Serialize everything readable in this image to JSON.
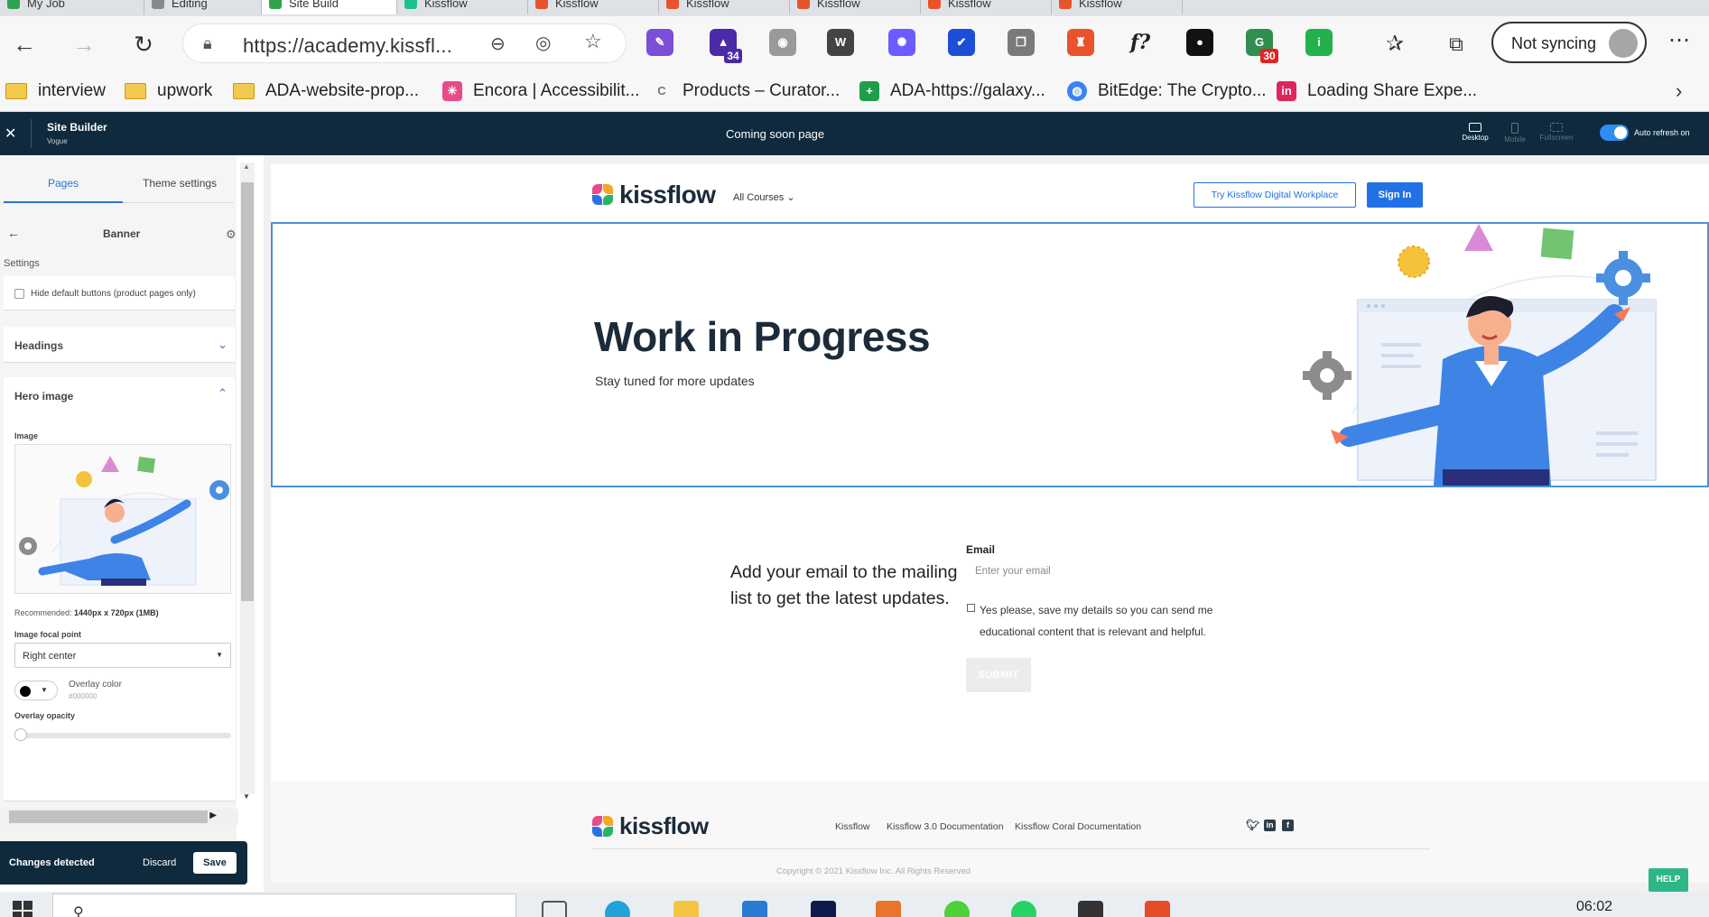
{
  "browser": {
    "tabs": [
      {
        "title": "My Job",
        "color": "#2ea44f"
      },
      {
        "title": "Editing",
        "color": "#888888"
      },
      {
        "title": "Site Build",
        "color": "#2ea44f",
        "active": true
      },
      {
        "title": "Kissflow",
        "color": "#20c08b"
      },
      {
        "title": "Kissflow",
        "color": "#e8532b"
      },
      {
        "title": "Kissflow",
        "color": "#e8532b"
      },
      {
        "title": "Kissflow",
        "color": "#e8532b"
      },
      {
        "title": "Kissflow",
        "color": "#e8532b"
      },
      {
        "title": "Kissflow",
        "color": "#e8532b"
      }
    ],
    "url": "https://academy.kissfl...",
    "sync_label": "Not syncing",
    "extensions": [
      {
        "name": "pen-extension-icon",
        "glyph": "✎",
        "color": "#7b4fd6"
      },
      {
        "name": "graduation-extension-icon",
        "glyph": "▲",
        "color": "#4b2aa8",
        "badge": "34",
        "badge_color": "#4b2aa8"
      },
      {
        "name": "camera-extension-icon",
        "glyph": "◉",
        "color": "#9a9a9a"
      },
      {
        "name": "w-extension-icon",
        "glyph": "W",
        "color": "#444444"
      },
      {
        "name": "spark-extension-icon",
        "glyph": "✺",
        "color": "#6a5cff"
      },
      {
        "name": "check-extension-icon",
        "glyph": "✔",
        "color": "#1d4ed8"
      },
      {
        "name": "copy-extension-icon",
        "glyph": "❐",
        "color": "#7a7a7a"
      },
      {
        "name": "lighthouse-extension-icon",
        "glyph": "♜",
        "color": "#e8532b"
      },
      {
        "name": "formula-extension-icon",
        "glyph": "f?",
        "color": "#f7f7f7"
      },
      {
        "name": "dark-extension-icon",
        "glyph": "●",
        "color": "#111111"
      },
      {
        "name": "grammar-extension-icon",
        "glyph": "G",
        "color": "#2f8f4f",
        "badge": "30",
        "badge_color": "#e02424"
      },
      {
        "name": "tag-extension-icon",
        "glyph": "i",
        "color": "#22b14c"
      }
    ],
    "bookmarks": [
      {
        "label": "interview",
        "type": "folder"
      },
      {
        "label": "upwork",
        "type": "folder"
      },
      {
        "label": "ADA-website-prop...",
        "type": "folder"
      },
      {
        "label": "Encora | Accessibilit...",
        "type": "site",
        "color": "#e84b8a",
        "glyph": "✳"
      },
      {
        "label": "Products – Curator...",
        "type": "site",
        "color": "#8a8a8a",
        "glyph": "C"
      },
      {
        "label": "ADA-https://galaxy...",
        "type": "site",
        "color": "#1e9e4a",
        "glyph": "+"
      },
      {
        "label": "BitEdge: The Crypto...",
        "type": "site",
        "color": "#3b82f6",
        "glyph": "◍"
      },
      {
        "label": "Loading Share Expe...",
        "type": "site",
        "color": "#e0245e",
        "glyph": "in"
      }
    ]
  },
  "builder": {
    "title": "Site Builder",
    "subtitle": "Vogue",
    "page_name": "Coming soon page",
    "views": [
      "Desktop",
      "Mobile",
      "Fullscreen"
    ],
    "auto_refresh_label": "Auto refresh on"
  },
  "panel": {
    "tabs": [
      "Pages",
      "Theme settings"
    ],
    "section_title": "Banner",
    "settings_label": "Settings",
    "hide_buttons_label": "Hide default buttons (product pages only)",
    "headings_label": "Headings",
    "hero_label": "Hero image",
    "image_label": "Image",
    "recommended_prefix": "Recommended: ",
    "recommended_value": "1440px x 720px (1MB)",
    "focal_label": "Image focal point",
    "focal_value": "Right center",
    "overlay_label": "Overlay color",
    "overlay_hex": "#000000",
    "opacity_label": "Overlay opacity",
    "opacity_value": 0,
    "changes_label": "Changes detected",
    "discard_label": "Discard",
    "save_label": "Save"
  },
  "site": {
    "logo_text": "kissflow",
    "courses_label": "All Courses",
    "try_label": "Try Kissflow Digital Workplace",
    "signin_label": "Sign In",
    "hero_title": "Work in Progress",
    "hero_subtitle": "Stay tuned for more updates",
    "mailing_text": "Add your email to the mailing list to get the latest updates.",
    "email_label": "Email",
    "email_placeholder": "Enter your email",
    "consent_text": "Yes please, save my details so you can send me educational content that is relevant and helpful.",
    "submit_label": "SUBMIT",
    "footer_links": [
      "Kissflow",
      "Kissflow 3.0 Documentation",
      "Kissflow Coral Documentation"
    ],
    "copyright": "Copyright © 2021 Kissflow Inc. All Rights Reserved",
    "help_label": "HELP"
  },
  "taskbar": {
    "time": "06:02"
  },
  "colors": {
    "brand_blue": "#2170e6",
    "builder_navy": "#0e2a3c",
    "selection_blue": "#4a90d9"
  }
}
